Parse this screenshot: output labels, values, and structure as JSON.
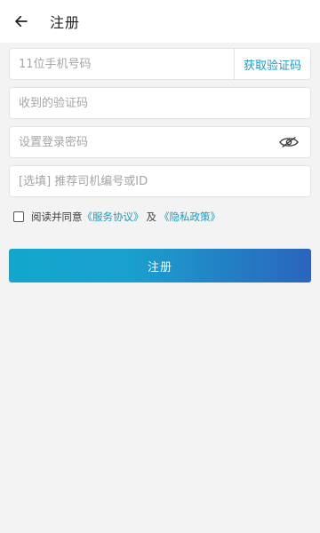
{
  "header": {
    "title": "注册",
    "back_icon": "arrow-left-icon"
  },
  "form": {
    "phone": {
      "placeholder": "11位手机号码",
      "value": ""
    },
    "get_code_label": "获取验证码",
    "code": {
      "placeholder": "收到的验证码",
      "value": ""
    },
    "password": {
      "placeholder": "设置登录密码",
      "value": "",
      "toggle_icon": "eye-hidden-icon"
    },
    "referral": {
      "placeholder": "[选填] 推荐司机编号或ID",
      "value": ""
    }
  },
  "agreement": {
    "checked": false,
    "prefix": "阅读并同意",
    "service_link": "《服务协议》",
    "joiner": "及",
    "privacy_link": "《隐私政策》"
  },
  "submit_label": "注册",
  "colors": {
    "accent": "#1d9bc0",
    "gradient_start": "#12a7cc",
    "gradient_end": "#2b64bd"
  }
}
